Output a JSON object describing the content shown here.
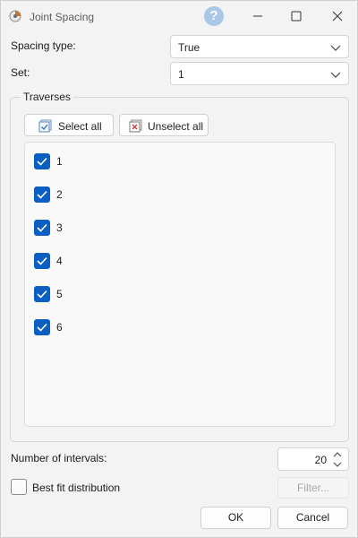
{
  "window": {
    "title": "Joint Spacing",
    "help_label": "?",
    "icons": [
      "app-icon",
      "help-icon",
      "minimize-icon",
      "maximize-icon",
      "close-icon"
    ]
  },
  "spacing_type": {
    "label": "Spacing type:",
    "value": "True"
  },
  "set": {
    "label": "Set:",
    "value": "1"
  },
  "traverses": {
    "title": "Traverses",
    "select_all": "Select all",
    "unselect_all": "Unselect all",
    "items": [
      {
        "label": "1",
        "checked": true
      },
      {
        "label": "2",
        "checked": true
      },
      {
        "label": "3",
        "checked": true
      },
      {
        "label": "4",
        "checked": true
      },
      {
        "label": "5",
        "checked": true
      },
      {
        "label": "6",
        "checked": true
      }
    ]
  },
  "intervals": {
    "label": "Number of intervals:",
    "value": "20"
  },
  "best_fit": {
    "label": "Best fit distribution",
    "checked": false
  },
  "filter_button": {
    "label": "Filter...",
    "enabled": false
  },
  "buttons": {
    "ok": "OK",
    "cancel": "Cancel"
  },
  "colors": {
    "accent": "#0b5fc2",
    "background": "#f3f3f3",
    "help": "#a9c7e6"
  }
}
